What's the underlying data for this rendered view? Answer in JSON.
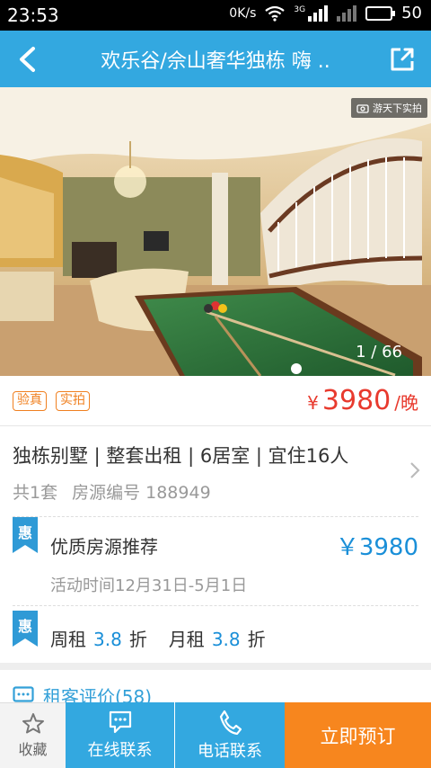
{
  "status_bar": {
    "time": "23:53",
    "net_speed": "0K/s",
    "signal_label": "3G",
    "battery": "50"
  },
  "header": {
    "title": "欢乐谷/佘山奢华独栋 嗨 ..",
    "back_icon": "chevron-left-icon",
    "share_icon": "share-icon"
  },
  "photo": {
    "badge": "游天下实拍",
    "counter": "1 / 66"
  },
  "tags": [
    "验真",
    "实拍"
  ],
  "price": {
    "currency": "¥",
    "amount": "3980",
    "unit": "/晚"
  },
  "listing": {
    "headline": "独栋别墅 | 整套出租 | 6居室 | 宜住16人",
    "count": "共1套",
    "code": "房源编号 188949"
  },
  "promo": {
    "badge": "惠",
    "title": "优质房源推荐",
    "price": "￥3980",
    "period": "活动时间12月31日-5月1日"
  },
  "discount": {
    "badge": "惠",
    "weekly_label": "周租",
    "weekly_value": "3.8",
    "weekly_unit": "折",
    "monthly_label": "月租",
    "monthly_value": "3.8",
    "monthly_unit": "折"
  },
  "reviews": {
    "label": "租客评价(58)"
  },
  "bottom_bar": {
    "favorite": "收藏",
    "online": "在线联系",
    "phone": "电话联系",
    "book": "立即预订"
  },
  "colors": {
    "primary": "#33a8e0",
    "price_red": "#e83a2e",
    "accent_orange": "#f7861e",
    "link_blue": "#1a8fd8"
  }
}
